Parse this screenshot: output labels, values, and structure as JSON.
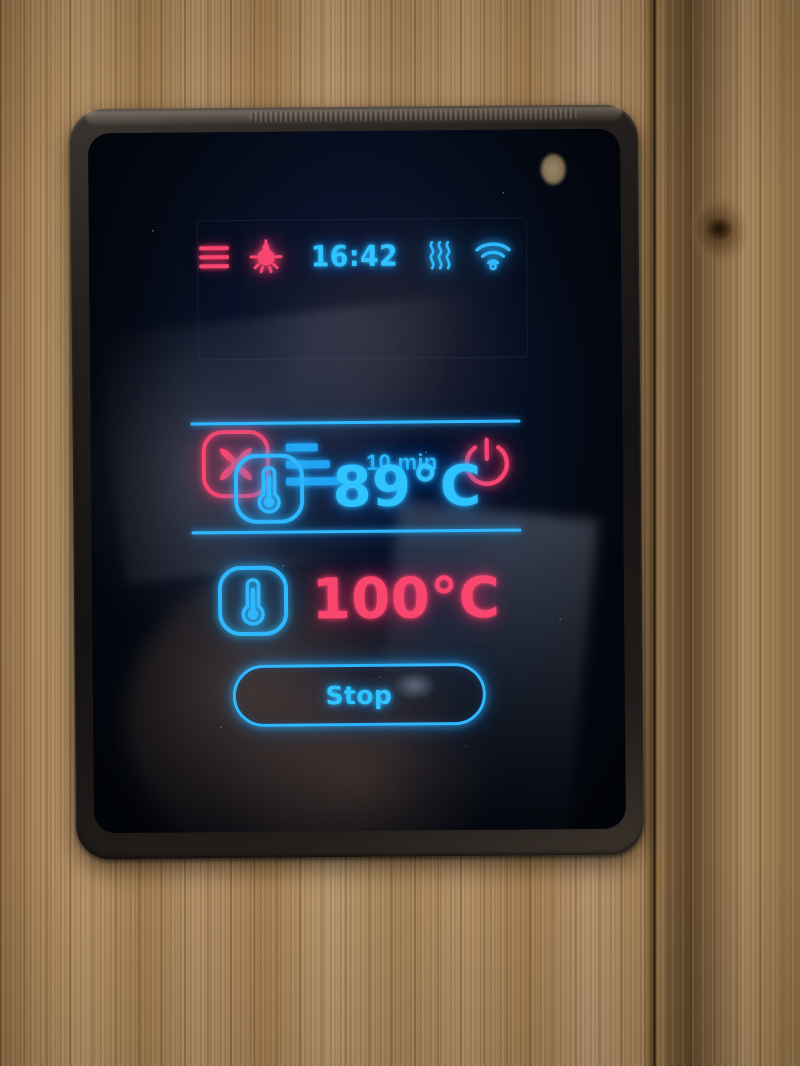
{
  "device": {
    "type": "sauna-control-panel",
    "screen_background": "#050c1c"
  },
  "colors": {
    "accent_cyan": "#2fc3ff",
    "accent_pink": "#f9466f",
    "screen_bg": "#050c1c",
    "bezel": "#201b18",
    "wood": "#a9855a"
  },
  "statusbar": {
    "menu_icon": "hamburger-menu-icon",
    "light_icon": "light-bulb-icon",
    "time": "16:42",
    "steam_icon": "steam-waves-icon",
    "wifi_icon": "wifi-icon"
  },
  "fan_row": {
    "fan_icon": "fan-icon",
    "speed_icon": "fan-speed-bars-icon",
    "speed_level": 3,
    "timer": "10 min",
    "power_icon": "power-icon"
  },
  "temperature": {
    "current": {
      "icon": "thermometer-icon",
      "value": "89°C",
      "color": "#2fc3ff",
      "role": "current-temperature"
    },
    "target": {
      "icon": "thermometer-icon",
      "value": "100°C",
      "color": "#f9466f",
      "role": "target-temperature"
    }
  },
  "action": {
    "stop_label": "Stop"
  }
}
